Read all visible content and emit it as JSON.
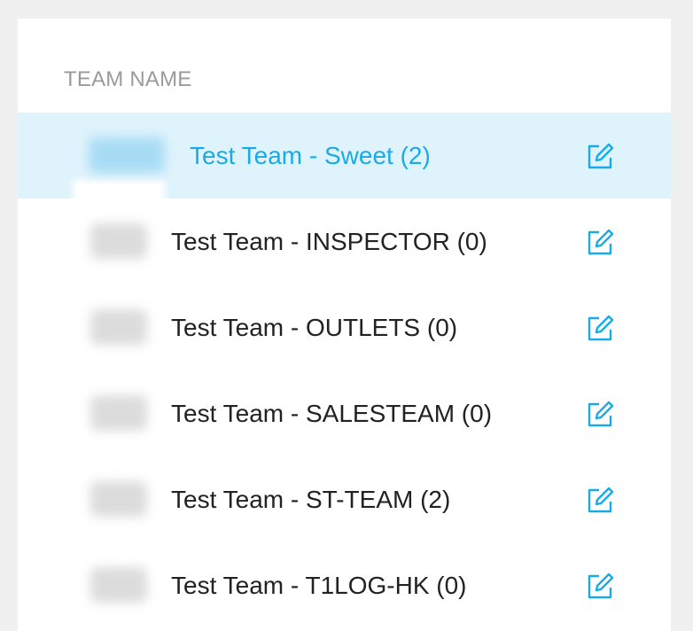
{
  "table": {
    "column_header": "TEAM NAME",
    "rows": [
      {
        "name": "Test Team - Sweet (2)",
        "selected": true
      },
      {
        "name": "Test Team - INSPECTOR (0)",
        "selected": false
      },
      {
        "name": "Test Team - OUTLETS (0)",
        "selected": false
      },
      {
        "name": "Test Team - SALESTEAM (0)",
        "selected": false
      },
      {
        "name": "Test Team - ST-TEAM (2)",
        "selected": false
      },
      {
        "name": "Test Team - T1LOG-HK (0)",
        "selected": false
      }
    ]
  },
  "icons": {
    "edit": "edit-icon",
    "avatar": "blurred-avatar"
  },
  "colors": {
    "accent": "#1aabe6",
    "selected_row_bg": "#dff3fc",
    "header_text": "#9a9a9a",
    "page_bg": "#f0f0f0"
  }
}
